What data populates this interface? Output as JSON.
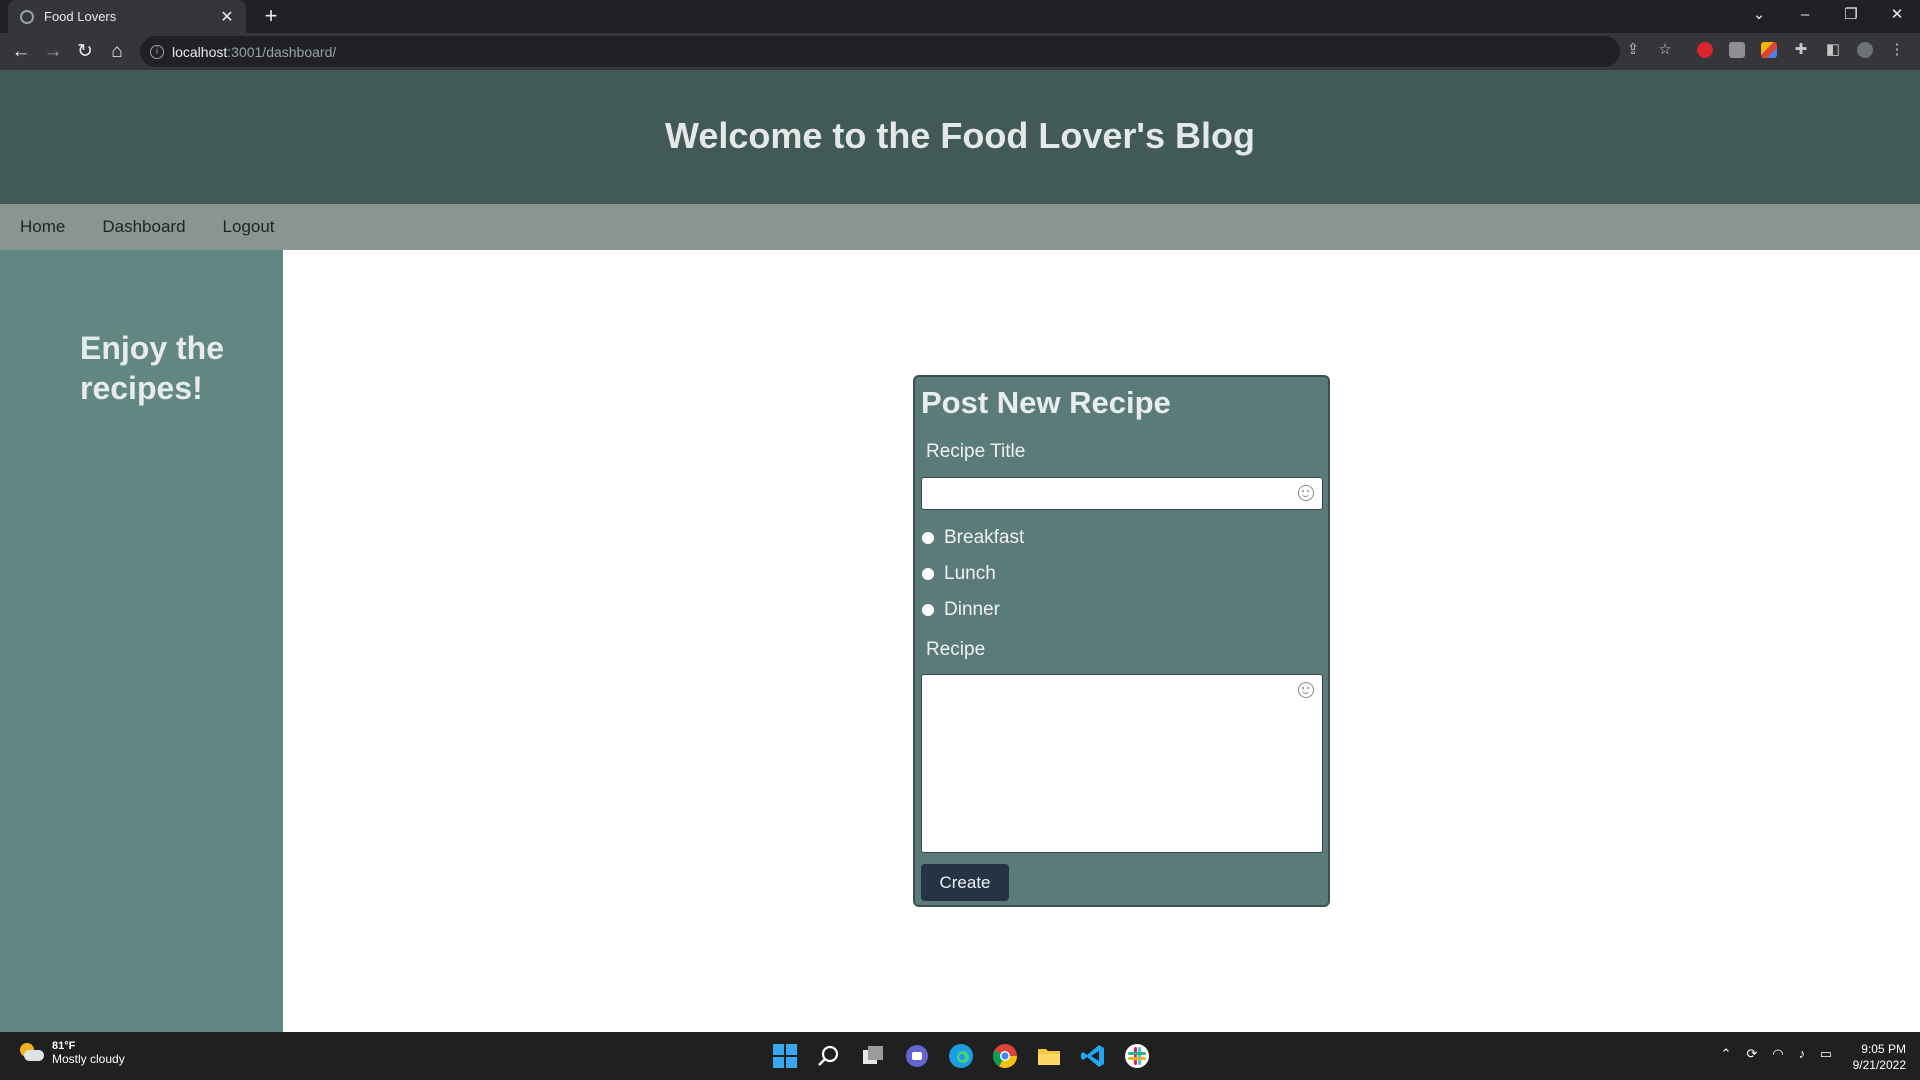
{
  "browser": {
    "tab_title": "Food Lovers",
    "close_tab": "✕",
    "new_tab": "+",
    "url_host": "localhost",
    "url_path": ":3001/dashboard/"
  },
  "header": {
    "title": "Welcome to the Food Lover's Blog"
  },
  "nav": {
    "home": "Home",
    "dashboard": "Dashboard",
    "logout": "Logout"
  },
  "sidebar": {
    "heading": "Enjoy the recipes!"
  },
  "form": {
    "heading": "Post New Recipe",
    "title_label": "Recipe Title",
    "title_value": "",
    "meal_options": [
      "Breakfast",
      "Lunch",
      "Dinner"
    ],
    "recipe_label": "Recipe",
    "recipe_value": "",
    "submit_label": "Create"
  },
  "taskbar": {
    "temperature": "81°F",
    "weather": "Mostly cloudy",
    "time": "9:05 PM",
    "date": "9/21/2022"
  }
}
